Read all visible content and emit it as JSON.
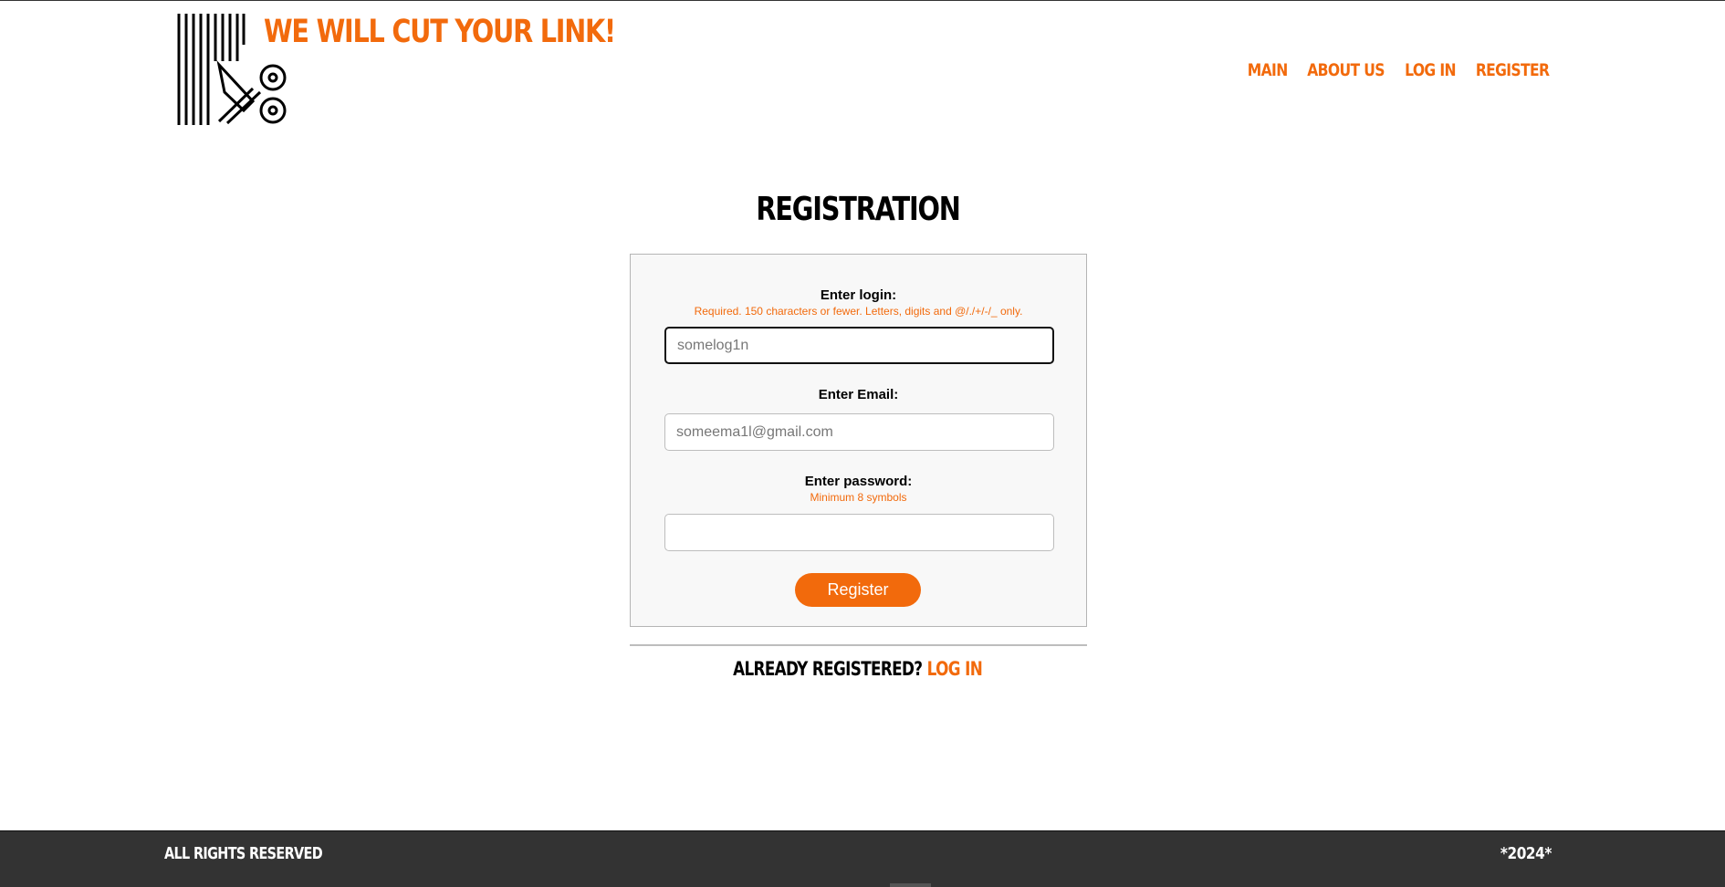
{
  "header": {
    "site_title": "WE WILL CUT YOUR LINK!",
    "logo_icon": "scissors-barcode-icon",
    "nav": [
      {
        "label": "MAIN"
      },
      {
        "label": "ABOUT US"
      },
      {
        "label": "LOG IN"
      },
      {
        "label": "REGISTER"
      }
    ]
  },
  "main": {
    "heading": "REGISTRATION",
    "form": {
      "login": {
        "label": "Enter login:",
        "help": "Required. 150 characters or fewer. Letters, digits and @/./+/-/_ only.",
        "placeholder": "somelog1n",
        "value": ""
      },
      "email": {
        "label": "Enter Email:",
        "placeholder": "someema1l@gmail.com",
        "value": ""
      },
      "password": {
        "label": "Enter password:",
        "help": "Minimum 8 symbols",
        "value": ""
      },
      "submit_label": "Register"
    },
    "login_prompt": {
      "question": "ALREADY REGISTERED?",
      "link_label": "LOG IN"
    }
  },
  "footer": {
    "left": "ALL RIGHTS RESERVED",
    "right": "*2024*"
  },
  "colors": {
    "accent": "#f26a0c",
    "footer_bg": "#333333",
    "form_bg": "#f8f8f8"
  }
}
